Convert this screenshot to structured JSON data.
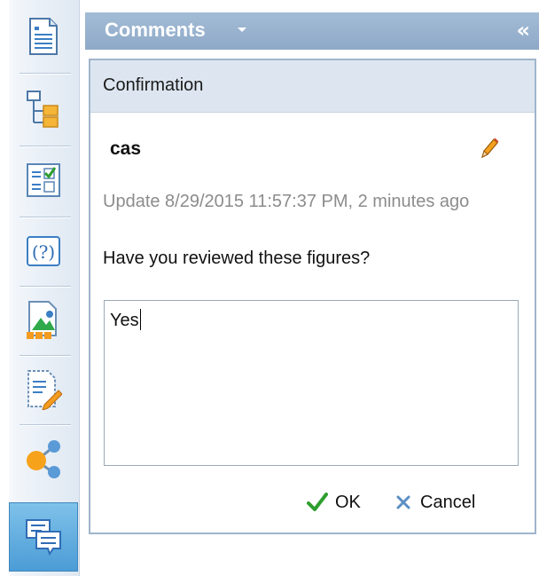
{
  "toolbar": {
    "items": [
      {
        "icon": "document-list-icon"
      },
      {
        "icon": "tree-structure-icon"
      },
      {
        "icon": "checklist-icon"
      },
      {
        "icon": "help-icon"
      },
      {
        "icon": "image-chart-icon"
      },
      {
        "icon": "edit-document-icon"
      },
      {
        "icon": "share-icon"
      },
      {
        "icon": "comments-icon",
        "active": true
      }
    ]
  },
  "header": {
    "title": "Comments",
    "collapse_symbol": "«"
  },
  "panel": {
    "title": "Confirmation",
    "author": "cas",
    "update_text": "Update 8/29/2015 11:57:37 PM, 2 minutes ago",
    "question": "Have you reviewed these figures?",
    "answer": "Yes",
    "ok_label": "OK",
    "cancel_label": "Cancel"
  },
  "colors": {
    "header": "#98b3cf",
    "ok_check": "#2e9e2e",
    "cancel_x": "#5a8fc3",
    "active_tool": "#5aa8dc"
  }
}
